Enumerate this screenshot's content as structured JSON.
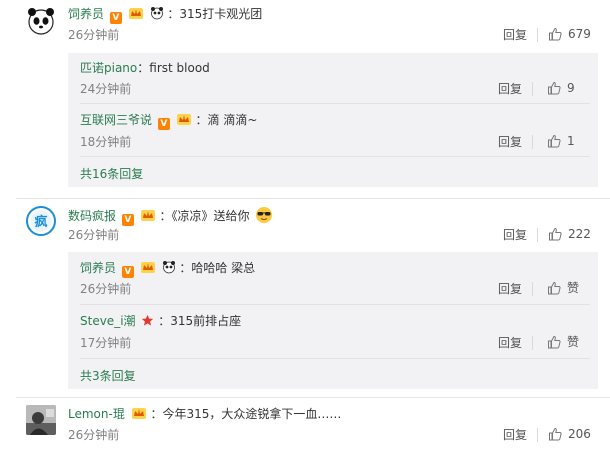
{
  "comments": [
    {
      "username": "饲养员",
      "text": "：315打卡观光团",
      "time": "26分钟前",
      "reply_label": "回复",
      "likes": "679",
      "avatar_icon": "panda-avatar",
      "replies": [
        {
          "username": "匹诺piano",
          "text": "：first blood",
          "time": "24分钟前",
          "reply_label": "回复",
          "likes": "9"
        },
        {
          "username": "互联网三爷说",
          "text": "：滴 滴滴~",
          "time": "18分钟前",
          "reply_label": "回复",
          "likes": "1"
        }
      ],
      "more_label": "共16条回复"
    },
    {
      "username": "数码疯报",
      "text": "：《凉凉》送给你",
      "time": "26分钟前",
      "reply_label": "回复",
      "likes": "222",
      "avatar_icon": "feng-logo-avatar",
      "replies": [
        {
          "username": "饲养员",
          "text": "：哈哈哈 梁总",
          "time": "26分钟前",
          "reply_label": "回复",
          "likes": "赞"
        },
        {
          "username": "Steve_i潮",
          "text": "：315前排占座",
          "time": "17分钟前",
          "reply_label": "回复",
          "likes": "赞"
        }
      ],
      "more_label": "共3条回复"
    },
    {
      "username": "Lemon-琨",
      "text": "：今年315，大众途锐拿下一血……",
      "time": "26分钟前",
      "reply_label": "回复",
      "likes": "206",
      "avatar_icon": "photo-avatar"
    }
  ],
  "colors": {
    "username": "#2a7c4f",
    "meta": "#808080",
    "panel": "#f2f2f5",
    "vip": "#ff8200"
  }
}
